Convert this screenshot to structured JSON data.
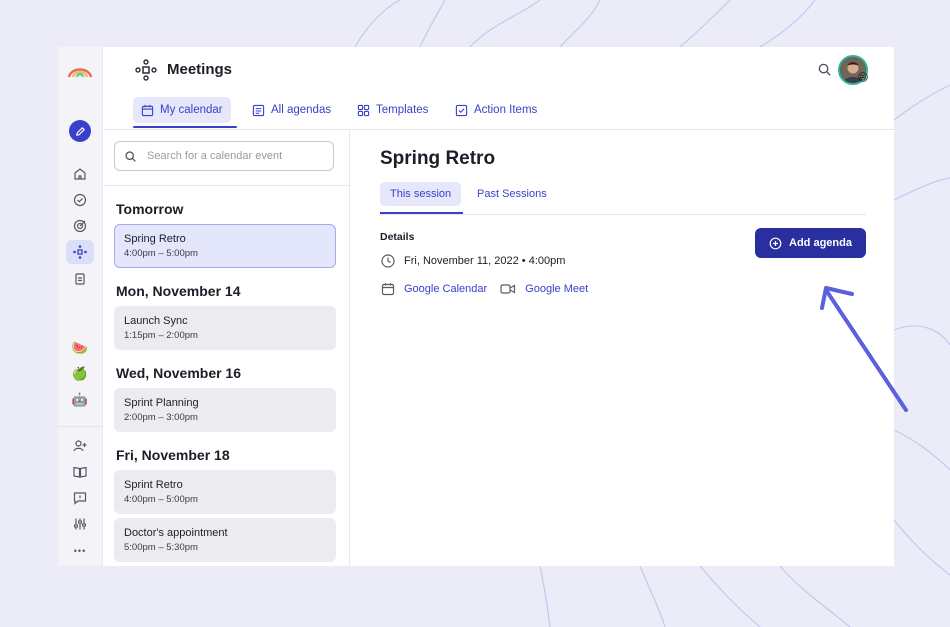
{
  "app": {
    "title": "Meetings",
    "colors": {
      "accent": "#3a40c9",
      "button": "#2a2fa0",
      "background": "#ececf8"
    }
  },
  "nav": {
    "tabs": [
      {
        "label": "My calendar",
        "icon": "calendar-icon",
        "active": true
      },
      {
        "label": "All agendas",
        "icon": "list-icon",
        "active": false
      },
      {
        "label": "Templates",
        "icon": "grid-icon",
        "active": false
      },
      {
        "label": "Action Items",
        "icon": "checkbox-icon",
        "active": false
      }
    ]
  },
  "sidebar": {
    "items": [
      {
        "icon": "home-icon"
      },
      {
        "icon": "check-circle-icon"
      },
      {
        "icon": "target-icon"
      },
      {
        "icon": "meetings-icon",
        "active": true
      },
      {
        "icon": "clipboard-icon"
      },
      {
        "icon": "watermelon-icon",
        "emoji": "🍉"
      },
      {
        "icon": "apple-icon",
        "emoji": "🍏"
      },
      {
        "icon": "robot-icon",
        "emoji": "🤖"
      },
      {
        "icon": "add-user-icon"
      },
      {
        "icon": "book-icon"
      },
      {
        "icon": "chat-icon"
      },
      {
        "icon": "sliders-icon"
      },
      {
        "icon": "more-icon",
        "label": "•••"
      }
    ]
  },
  "search": {
    "placeholder": "Search for a calendar event"
  },
  "calendar": {
    "days": [
      {
        "heading": "Tomorrow",
        "events": [
          {
            "title": "Spring Retro",
            "time": "4:00pm – 5:00pm",
            "selected": true
          }
        ]
      },
      {
        "heading": "Mon, November 14",
        "events": [
          {
            "title": "Launch Sync",
            "time": "1:15pm – 2:00pm"
          }
        ]
      },
      {
        "heading": "Wed, November 16",
        "events": [
          {
            "title": "Sprint Planning",
            "time": "2:00pm – 3:00pm"
          }
        ]
      },
      {
        "heading": "Fri, November 18",
        "events": [
          {
            "title": "Sprint Retro",
            "time": "4:00pm – 5:00pm"
          },
          {
            "title": "Doctor's appointment",
            "time": "5:00pm – 5:30pm"
          }
        ]
      }
    ]
  },
  "detail": {
    "title": "Spring Retro",
    "tabs": [
      {
        "label": "This session",
        "active": true
      },
      {
        "label": "Past Sessions",
        "active": false
      }
    ],
    "details_label": "Details",
    "datetime": "Fri, November 11, 2022 • 4:00pm",
    "links": [
      {
        "label": "Google Calendar",
        "icon": "calendar-icon"
      },
      {
        "label": "Google Meet",
        "icon": "video-icon"
      }
    ],
    "add_agenda_label": "Add agenda"
  }
}
